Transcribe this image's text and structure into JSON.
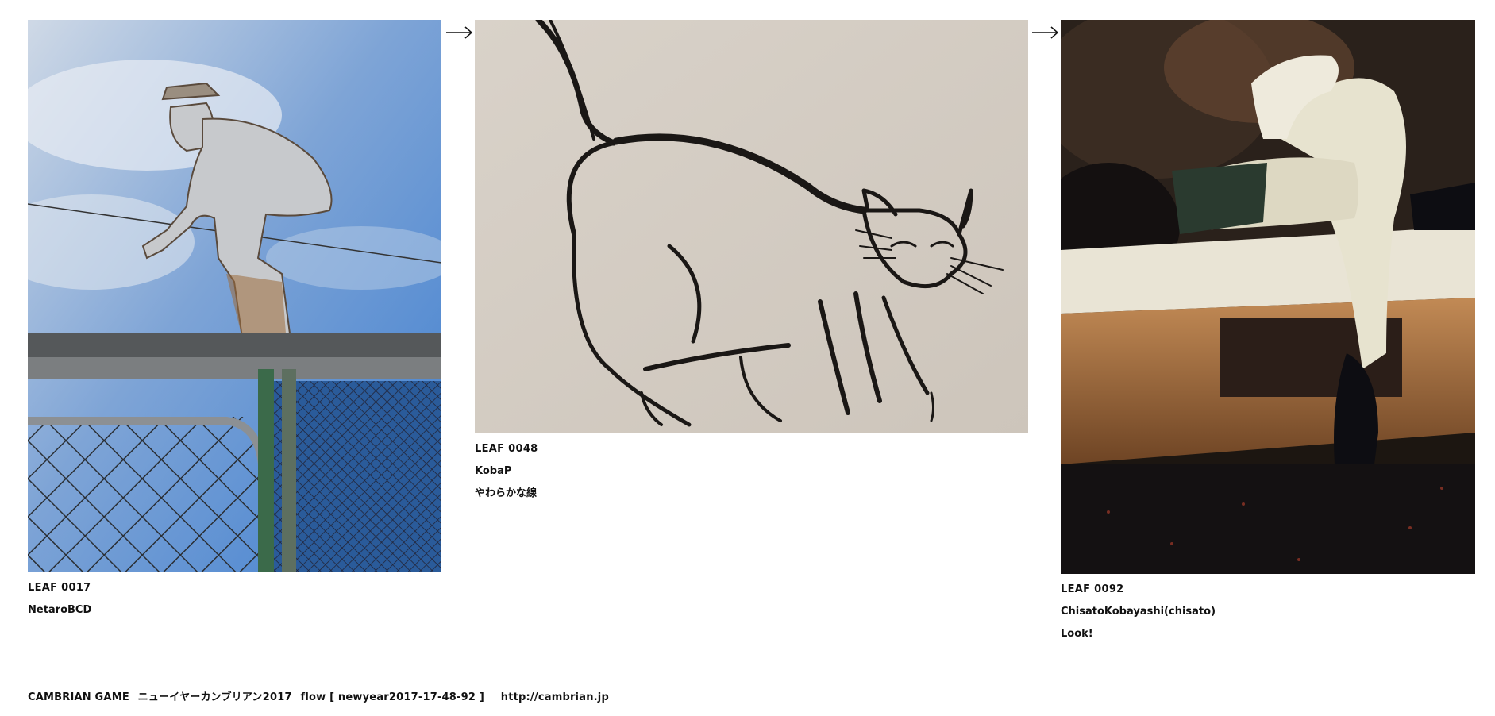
{
  "leaves": [
    {
      "code": "LEAF 0017",
      "author": "NetaroBCD",
      "title": "",
      "image_subject": "cut-out metal figure of a crouching man on a fence against blue sky"
    },
    {
      "code": "LEAF 0048",
      "author": "KobaP",
      "title": "やわらかな線",
      "image_subject": "ink line drawing of a stretching cat on a wall"
    },
    {
      "code": "LEAF 0092",
      "author": "ChisatoKobayashi(chisato)",
      "title": "Look!",
      "image_subject": "mannequin legs with black boots in a shop window"
    }
  ],
  "arrows": [
    "arrow-right-icon",
    "arrow-right-icon"
  ],
  "footer": {
    "game": "CAMBRIAN GAME",
    "event": "ニューイヤーカンブリアン2017",
    "flow": "flow [ newyear2017-17-48-92 ]",
    "url": "http://cambrian.jp"
  }
}
